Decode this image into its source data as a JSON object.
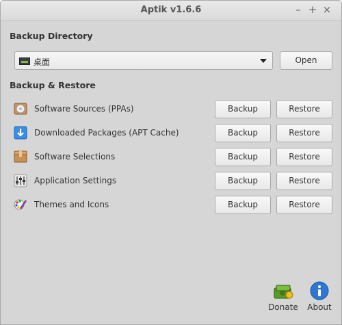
{
  "window": {
    "title": "Aptik v1.6.6",
    "minimize_glyph": "–",
    "maximize_glyph": "+",
    "close_glyph": "×"
  },
  "backup_directory": {
    "heading": "Backup Directory",
    "selected": "桌面",
    "open_label": "Open"
  },
  "backup_restore": {
    "heading": "Backup & Restore",
    "items": [
      {
        "label": "Software Sources (PPAs)",
        "icon": "software-sources-icon",
        "backup": "Backup",
        "restore": "Restore"
      },
      {
        "label": "Downloaded Packages (APT Cache)",
        "icon": "download-icon",
        "backup": "Backup",
        "restore": "Restore"
      },
      {
        "label": "Software Selections",
        "icon": "package-icon",
        "backup": "Backup",
        "restore": "Restore"
      },
      {
        "label": "Application Settings",
        "icon": "settings-sliders-icon",
        "backup": "Backup",
        "restore": "Restore"
      },
      {
        "label": "Themes and Icons",
        "icon": "themes-icon",
        "backup": "Backup",
        "restore": "Restore"
      }
    ]
  },
  "footer": {
    "donate_label": "Donate",
    "about_label": "About"
  },
  "colors": {
    "window_bg": "#d6d6d6",
    "about_blue": "#2a78d4",
    "donate_green": "#4e8a1f"
  }
}
